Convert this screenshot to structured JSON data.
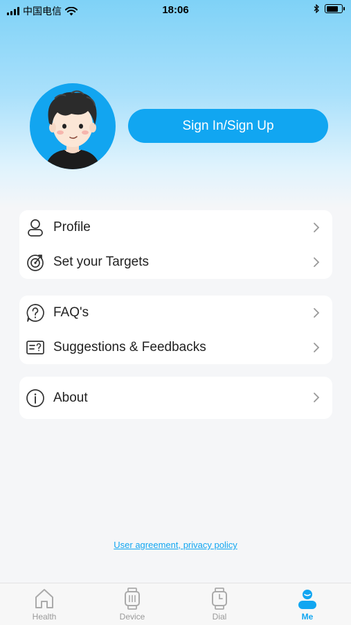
{
  "status_bar": {
    "carrier": "中国电信",
    "time": "18:06"
  },
  "header": {
    "signin_label": "Sign In/Sign Up"
  },
  "menu": {
    "group1": [
      {
        "label": "Profile",
        "icon": "person-icon"
      },
      {
        "label": "Set your Targets",
        "icon": "target-icon"
      }
    ],
    "group2": [
      {
        "label": "FAQ's",
        "icon": "question-bubble-icon"
      },
      {
        "label": "Suggestions & Feedbacks",
        "icon": "feedback-icon"
      }
    ],
    "group3": [
      {
        "label": "About",
        "icon": "info-icon"
      }
    ]
  },
  "footer": {
    "links_label": "User agreement, privacy policy"
  },
  "tabs": [
    {
      "label": "Health",
      "icon": "house-icon"
    },
    {
      "label": "Device",
      "icon": "watch-icon"
    },
    {
      "label": "Dial",
      "icon": "watch-face-icon"
    },
    {
      "label": "Me",
      "icon": "person-icon",
      "active": true
    }
  ],
  "colors": {
    "accent": "#11a6f1",
    "gradient_top": "#7fd2f7"
  }
}
